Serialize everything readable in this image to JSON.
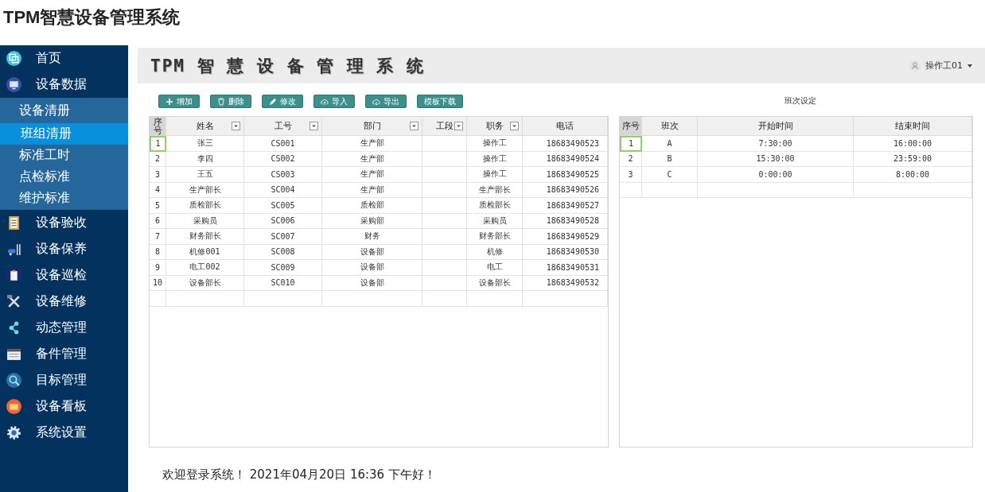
{
  "page_title": "TPM智慧设备管理系统",
  "sidebar": {
    "items": [
      {
        "label": "首页"
      },
      {
        "label": "设备数据",
        "children": [
          {
            "label": "设备清册",
            "selected": false
          },
          {
            "label": "班组清册",
            "selected": true
          },
          {
            "label": "标准工时",
            "selected": false
          },
          {
            "label": "点检标准",
            "selected": false
          },
          {
            "label": "维护标准",
            "selected": false
          }
        ]
      },
      {
        "label": "设备验收"
      },
      {
        "label": "设备保养"
      },
      {
        "label": "设备巡检"
      },
      {
        "label": "设备维修"
      },
      {
        "label": "动态管理"
      },
      {
        "label": "备件管理"
      },
      {
        "label": "目标管理"
      },
      {
        "label": "设备看板"
      },
      {
        "label": "系统设置"
      }
    ]
  },
  "header": {
    "title": "TPM 智 慧 设 备 管 理 系 统",
    "user": "操作工01"
  },
  "toolbar": [
    {
      "label": "增加",
      "kind": "add"
    },
    {
      "label": "删除",
      "kind": "delete"
    },
    {
      "label": "修改",
      "kind": "edit"
    },
    {
      "label": "导入",
      "kind": "upload"
    },
    {
      "label": "导出",
      "kind": "download"
    },
    {
      "label": "模板下载",
      "kind": "text"
    }
  ],
  "staff_table": {
    "columns": [
      {
        "label": "序号",
        "filter": false
      },
      {
        "label": "姓名",
        "filter": true
      },
      {
        "label": "工号",
        "filter": true
      },
      {
        "label": "部门",
        "filter": true
      },
      {
        "label": "工段",
        "filter": true
      },
      {
        "label": "职务",
        "filter": true
      },
      {
        "label": "电话",
        "filter": false
      }
    ],
    "rows": [
      {
        "focused": true,
        "cells": [
          "1",
          "张三",
          "CS001",
          "生产部",
          "",
          "操作工",
          "18683490523"
        ]
      },
      {
        "focused": false,
        "cells": [
          "2",
          "李四",
          "CS002",
          "生产部",
          "",
          "操作工",
          "18683490524"
        ]
      },
      {
        "focused": false,
        "cells": [
          "3",
          "王五",
          "CS003",
          "生产部",
          "",
          "操作工",
          "18683490525"
        ]
      },
      {
        "focused": false,
        "cells": [
          "4",
          "生产部长",
          "SC004",
          "生产部",
          "",
          "生产部长",
          "18683490526"
        ]
      },
      {
        "focused": false,
        "cells": [
          "5",
          "质检部长",
          "SC005",
          "质检部",
          "",
          "质检部长",
          "18683490527"
        ]
      },
      {
        "focused": false,
        "cells": [
          "6",
          "采购员",
          "SC006",
          "采购部",
          "",
          "采购员",
          "18683490528"
        ]
      },
      {
        "focused": false,
        "cells": [
          "7",
          "财务部长",
          "SC007",
          "财务",
          "",
          "财务部长",
          "18683490529"
        ]
      },
      {
        "focused": false,
        "cells": [
          "8",
          "机修001",
          "SC008",
          "设备部",
          "",
          "机修",
          "18683490530"
        ]
      },
      {
        "focused": false,
        "cells": [
          "9",
          "电工002",
          "SC009",
          "设备部",
          "",
          "电工",
          "18683490531"
        ]
      },
      {
        "focused": false,
        "cells": [
          "10",
          "设备部长",
          "SC010",
          "设备部",
          "",
          "设备部长",
          "18683490532"
        ]
      }
    ]
  },
  "shift_panel": {
    "title": "班次设定",
    "columns": [
      {
        "label": "序号"
      },
      {
        "label": "班次"
      },
      {
        "label": "开始时间"
      },
      {
        "label": "结束时间"
      }
    ],
    "rows": [
      {
        "focused": true,
        "cells": [
          "1",
          "A",
          "7:30:00",
          "16:00:00"
        ]
      },
      {
        "focused": false,
        "cells": [
          "2",
          "B",
          "15:30:00",
          "23:59:00"
        ]
      },
      {
        "focused": false,
        "cells": [
          "3",
          "C",
          "0:00:00",
          "8:00:00"
        ]
      }
    ]
  },
  "footer": {
    "welcome": "欢迎登录系统！ 2021年04月20日 16:36 下午好！"
  }
}
